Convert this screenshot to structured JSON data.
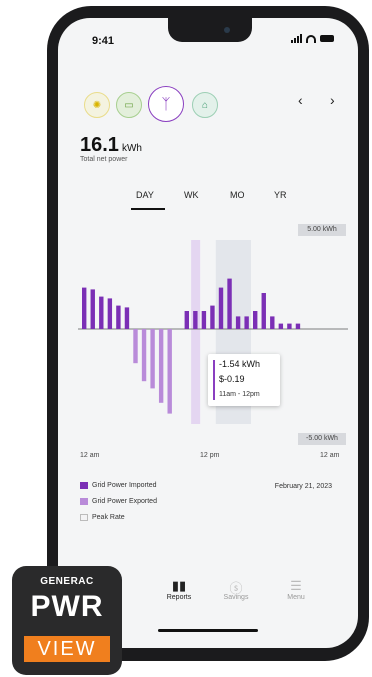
{
  "status": {
    "time": "9:41"
  },
  "sources": [
    {
      "name": "solar-icon",
      "glyph": "✺",
      "color": "#d9b400"
    },
    {
      "name": "battery-icon",
      "glyph": "▭",
      "color": "#6aa040"
    },
    {
      "name": "grid-tower-icon",
      "glyph": "ᛉ",
      "color": "#8a3fc0"
    },
    {
      "name": "home-icon",
      "glyph": "⌂",
      "color": "#3e9a6e"
    }
  ],
  "nav_arrows": {
    "prev": "‹",
    "next": "›"
  },
  "summary": {
    "value": "16.1",
    "unit": "kWh",
    "label": "Total net power"
  },
  "period_tabs": {
    "day": "DAY",
    "week": "WK",
    "month": "MO",
    "year": "YR",
    "selected": "DAY"
  },
  "chart_data": {
    "type": "bar",
    "ylim": [
      -5,
      5
    ],
    "y_max_label": "5.00 kWh",
    "y_min_label": "-5.00 kWh",
    "x_tick_labels": [
      "12 am",
      "12 pm",
      "12 am"
    ],
    "series": [
      {
        "name": "Grid Power Imported",
        "color": "#7b2fb5",
        "values": [
          2.3,
          2.2,
          1.8,
          1.7,
          1.3,
          1.2,
          0,
          0,
          0,
          0,
          0,
          0,
          1.0,
          1.0,
          1.0,
          1.3,
          2.3,
          2.8,
          0.7,
          0.7,
          1.0,
          2.0,
          0.7,
          0.3,
          0.3,
          0.3
        ]
      },
      {
        "name": "Grid Power Exported",
        "color": "#b98bd9",
        "values": [
          0,
          0,
          0,
          0,
          0,
          0,
          -1.9,
          -2.9,
          -3.3,
          -4.1,
          -4.7,
          0,
          0,
          0,
          0,
          0,
          0,
          0,
          0,
          0,
          0,
          0,
          0,
          0,
          0,
          0
        ]
      }
    ],
    "highlighted_hour": {
      "label": "11am - 12pm",
      "value_kwh": -1.54
    },
    "peak_rate_hours": [
      16,
      20
    ]
  },
  "tooltip": {
    "kwh": "-1.54 kWh",
    "cost": "$-0.19",
    "time": "11am - 12pm"
  },
  "legend": {
    "imported": "Grid Power Imported",
    "exported": "Grid Power Exported",
    "peak": "Peak Rate",
    "date": "February 21, 2023"
  },
  "colors": {
    "imported": "#7b2fb5",
    "exported": "#b98bd9",
    "peak": "#dfe2e8",
    "accent": "#8a3fc0",
    "brand_orange": "#f07f1e"
  },
  "bottom_nav": {
    "hidden_label": "",
    "reports": "Reports",
    "savings": "Savings",
    "menu": "Menu"
  },
  "badge": {
    "brand": "GENERAC",
    "line1": "PWR",
    "line2": "VIEW"
  }
}
